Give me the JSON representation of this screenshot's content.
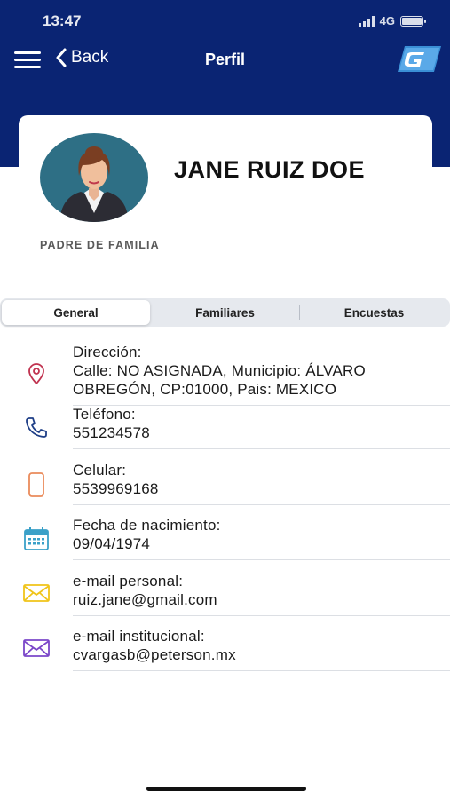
{
  "status_bar": {
    "time": "13:47",
    "network": "4G"
  },
  "nav": {
    "menu_icon": "hamburger-menu-icon",
    "back_label": "Back",
    "title": "Perfil"
  },
  "profile": {
    "name": "JANE RUIZ DOE",
    "role": "PADRE DE FAMILIA"
  },
  "tabs": [
    {
      "label": "General",
      "active": true
    },
    {
      "label": "Familiares",
      "active": false
    },
    {
      "label": "Encuestas",
      "active": false
    }
  ],
  "info": {
    "address": {
      "label": "Dirección:",
      "line1": "Calle: NO ASIGNADA, Municipio: ÁLVARO",
      "line2": "OBREGÓN, CP:01000, Pais: MEXICO",
      "icon": "location-pin-icon"
    },
    "phone": {
      "label": "Teléfono:",
      "value": "551234578",
      "icon": "phone-icon"
    },
    "mobile": {
      "label": "Celular:",
      "value": "5539969168",
      "icon": "mobile-phone-icon"
    },
    "birthdate": {
      "label": "Fecha de nacimiento:",
      "value": "09/04/1974",
      "icon": "calendar-icon"
    },
    "personal_email": {
      "label": "e-mail personal:",
      "value": "ruiz.jane@gmail.com",
      "icon": "envelope-icon"
    },
    "institutional_email": {
      "label": "e-mail institucional:",
      "value": "cvargasb@peterson.mx",
      "icon": "envelope-icon"
    }
  },
  "colors": {
    "header": "#0a2473",
    "pin": "#c0324f",
    "phone": "#1f3f87",
    "mobile": "#ea8b5b",
    "calendar": "#3aa0c8",
    "personal_email": "#f0c419",
    "institutional_email": "#7b47c9"
  }
}
